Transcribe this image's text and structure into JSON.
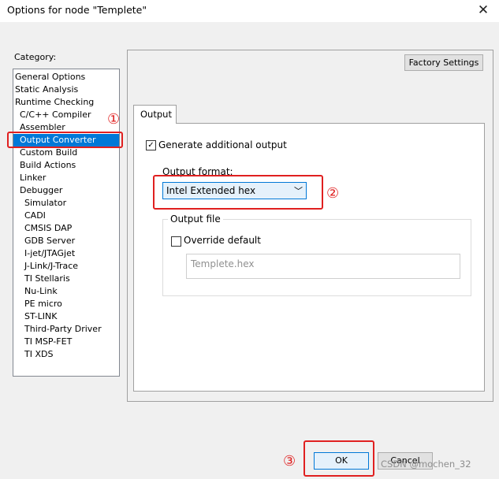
{
  "window": {
    "title": "Options for node \"Templete\"",
    "close_glyph": "✕"
  },
  "category": {
    "label": "Category:",
    "items": [
      {
        "label": "General Options",
        "indent": 0
      },
      {
        "label": "Static Analysis",
        "indent": 0
      },
      {
        "label": "Runtime Checking",
        "indent": 0
      },
      {
        "label": "C/C++ Compiler",
        "indent": 1
      },
      {
        "label": "Assembler",
        "indent": 1
      },
      {
        "label": "Output Converter",
        "indent": 1,
        "selected": true
      },
      {
        "label": "Custom Build",
        "indent": 1
      },
      {
        "label": "Build Actions",
        "indent": 1
      },
      {
        "label": "Linker",
        "indent": 1
      },
      {
        "label": "Debugger",
        "indent": 1
      },
      {
        "label": "Simulator",
        "indent": 2
      },
      {
        "label": "CADI",
        "indent": 2
      },
      {
        "label": "CMSIS DAP",
        "indent": 2
      },
      {
        "label": "GDB Server",
        "indent": 2
      },
      {
        "label": "I-jet/JTAGjet",
        "indent": 2
      },
      {
        "label": "J-Link/J-Trace",
        "indent": 2
      },
      {
        "label": "TI Stellaris",
        "indent": 2
      },
      {
        "label": "Nu-Link",
        "indent": 2
      },
      {
        "label": "PE micro",
        "indent": 2
      },
      {
        "label": "ST-LINK",
        "indent": 2
      },
      {
        "label": "Third-Party Driver",
        "indent": 2
      },
      {
        "label": "TI MSP-FET",
        "indent": 2
      },
      {
        "label": "TI XDS",
        "indent": 2
      }
    ]
  },
  "factory_settings_label": "Factory Settings",
  "tab_label": "Output",
  "generate_output": {
    "label": "Generate additional output",
    "checked": true
  },
  "output_format": {
    "label": "Output format:",
    "value": "Intel Extended hex"
  },
  "output_file": {
    "group_label": "Output file",
    "override_label": "Override default",
    "override_checked": false,
    "value": "Templete.hex"
  },
  "buttons": {
    "ok": "OK",
    "cancel": "Cancel"
  },
  "annotations": {
    "one": "①",
    "two": "②",
    "three": "③"
  },
  "watermark": "CSDN @mochen_32",
  "colors": {
    "selection": "#0078d7",
    "highlight": "#e02020"
  }
}
